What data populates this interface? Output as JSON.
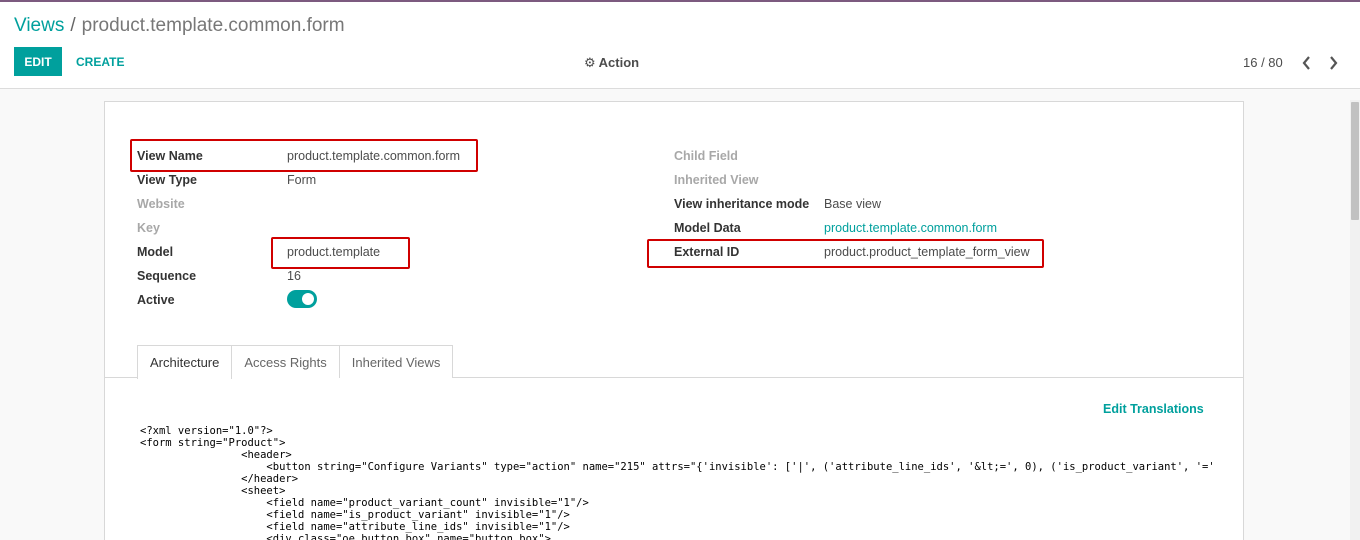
{
  "breadcrumb": {
    "parent": "Views",
    "separator": "/",
    "current": "product.template.common.form"
  },
  "toolbar": {
    "edit_label": "EDIT",
    "create_label": "CREATE",
    "action_label": "Action",
    "action_icon": "gear-icon"
  },
  "pager": {
    "value": "16 / 80",
    "prev_icon": "chevron-left-icon",
    "next_icon": "chevron-right-icon"
  },
  "form": {
    "left": [
      {
        "label": "View Name",
        "value": "product.template.common.form",
        "muted": false
      },
      {
        "label": "View Type",
        "value": "Form",
        "muted": false
      },
      {
        "label": "Website",
        "value": "",
        "muted": true
      },
      {
        "label": "Key",
        "value": "",
        "muted": true
      },
      {
        "label": "Model",
        "value": "product.template",
        "muted": false
      },
      {
        "label": "Sequence",
        "value": "16",
        "muted": false
      },
      {
        "label": "Active",
        "value": "",
        "muted": false
      }
    ],
    "right": [
      {
        "label": "Child Field",
        "value": "",
        "muted": true
      },
      {
        "label": "Inherited View",
        "value": "",
        "muted": true
      },
      {
        "label": "View inheritance mode",
        "value": "Base view",
        "muted": false
      },
      {
        "label": "Model Data",
        "value": "product.template.common.form",
        "muted": false,
        "link": true
      },
      {
        "label": "External ID",
        "value": "product.product_template_form_view",
        "muted": false
      }
    ],
    "active": true
  },
  "tabs": [
    {
      "label": "Architecture",
      "active": true
    },
    {
      "label": "Access Rights",
      "active": false
    },
    {
      "label": "Inherited Views",
      "active": false
    }
  ],
  "architecture": {
    "edit_translations_label": "Edit Translations",
    "code_lines": [
      "<?xml version=\"1.0\"?>",
      "<form string=\"Product\">",
      "                <header>",
      "                    <button string=\"Configure Variants\" type=\"action\" name=\"215\" attrs=\"{'invisible': ['|', ('attribute_line_ids', '&lt;=', 0), ('is_product_variant', '=', True)]}\"/>",
      "                </header>",
      "                <sheet>",
      "                    <field name=\"product_variant_count\" invisible=\"1\"/>",
      "                    <field name=\"is_product_variant\" invisible=\"1\"/>",
      "                    <field name=\"attribute_line_ids\" invisible=\"1\"/>",
      "                    <div class=\"oe_button_box\" name=\"button_box\">"
    ]
  },
  "colors": {
    "accent": "#00a09d",
    "highlight": "#d00000",
    "topbar": "#7c5a7f"
  }
}
